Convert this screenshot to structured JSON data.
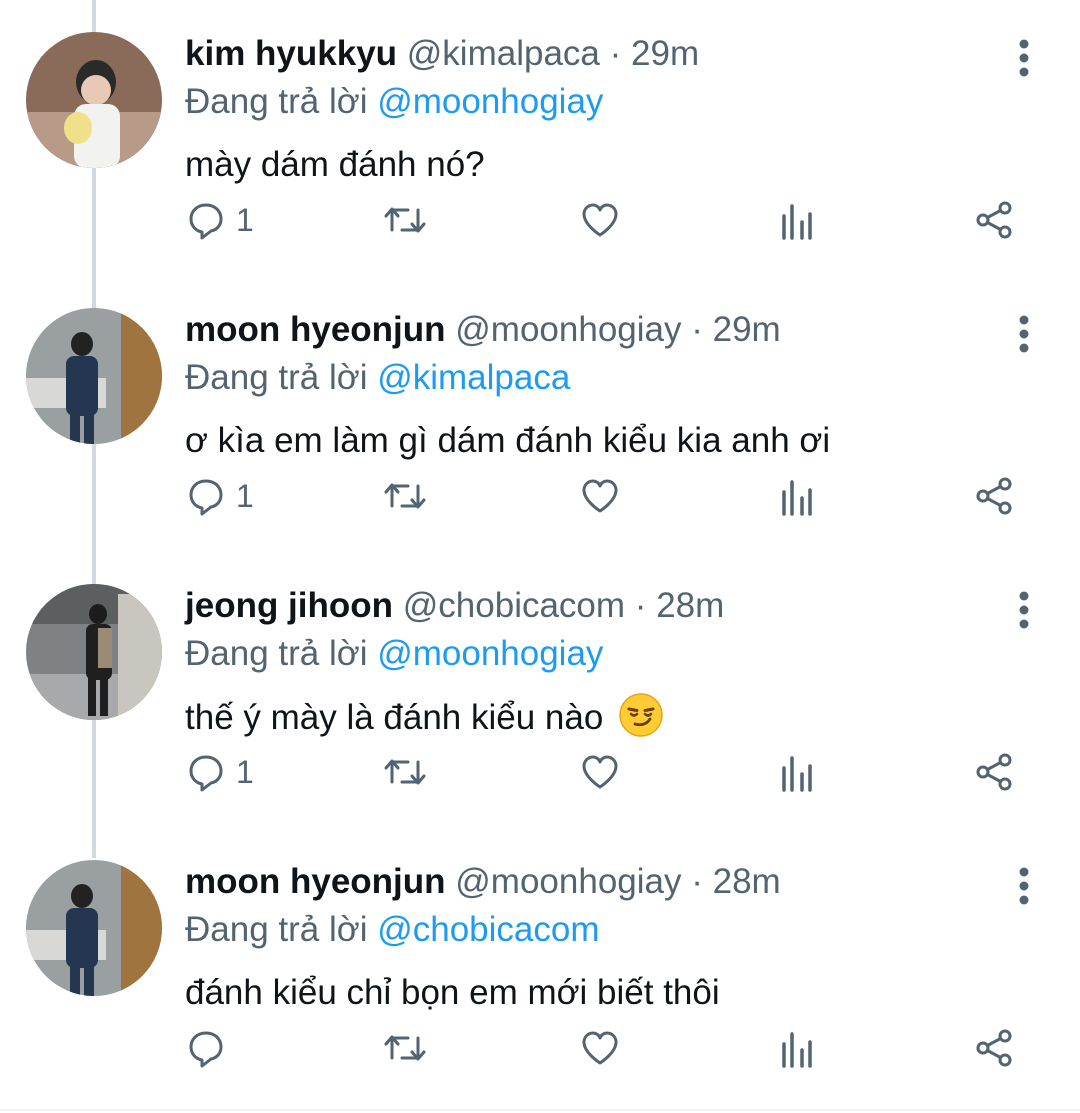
{
  "colors": {
    "accent": "#1d9bf0",
    "secondary_text": "#536471",
    "primary_text": "#0f1419"
  },
  "separator": "·",
  "reply_prefix": "Đang trả lời",
  "tweets": [
    {
      "name": "kim hyukkyu",
      "handle": "@kimalpaca",
      "time": "29m",
      "replying_to": "@moonhogiay",
      "text": "mày dám đánh nó?",
      "reply_count": "1",
      "avatar_icon": "avatar-person-icon"
    },
    {
      "name": "moon hyeonjun",
      "handle": "@moonhogiay",
      "time": "29m",
      "replying_to": "@kimalpaca",
      "text": "ơ kìa em làm gì dám đánh kiểu kia anh ơi",
      "reply_count": "1",
      "avatar_icon": "avatar-person-icon"
    },
    {
      "name": "jeong jihoon",
      "handle": "@chobicacom",
      "time": "28m",
      "replying_to": "@moonhogiay",
      "text": "thế ý mày là đánh kiểu nào",
      "emoji": "smirk-emoji-icon",
      "reply_count": "1",
      "avatar_icon": "avatar-person-icon"
    },
    {
      "name": "moon hyeonjun",
      "handle": "@moonhogiay",
      "time": "28m",
      "replying_to": "@chobicacom",
      "text": "đánh kiểu chỉ bọn em mới biết thôi",
      "reply_count": "",
      "avatar_icon": "avatar-person-icon"
    }
  ],
  "action_icons": [
    "reply-icon",
    "retweet-icon",
    "like-icon",
    "analytics-icon",
    "share-icon"
  ]
}
